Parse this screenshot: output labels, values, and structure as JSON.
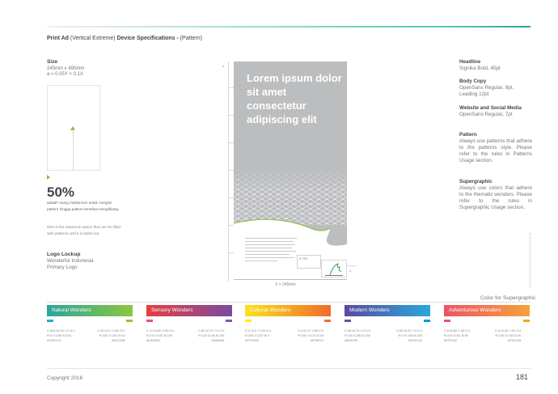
{
  "header": {
    "title_a": "Print Ad",
    "title_b": " (Vertical Extreme) ",
    "title_c": "Device Specifications - ",
    "title_d": "(Pattern)"
  },
  "left": {
    "size_label": "Size",
    "size_dim": "245mm x 490mm",
    "size_ratio": "a = 0.05Y × 0.1X",
    "percent": "50%",
    "percent_note": "adalah ruang maksimum untuk mengisi pattern hingga pattern tersebut menghilang.",
    "percent_note_en": "50% is the maximum space that can be filled with patterns until it is faded out",
    "logo_label": "Logo Lockup",
    "logo_line1": "Wonderful Indonesia",
    "logo_line2": "Primary Logo"
  },
  "ad": {
    "headline": "Lorem ipsum dolor sit amet consectetur adipiscing elit",
    "dim_bottom": "X = 245mm",
    "dim_side": "a",
    "dim_side_b": "a",
    "small_box": "0.75X",
    "colors": {
      "bg": "#bcbdbf",
      "accent": "#8ab83a"
    }
  },
  "specs": [
    {
      "heading": "Headline",
      "text": "Signika Bold, 45pt"
    },
    {
      "heading": "Body Copy",
      "text": "OpenSans Regular, 9pt, Leading 12pt"
    },
    {
      "heading": "Website and Social Media",
      "text": "OpenSans Regular, 7pt"
    },
    {
      "heading": "Pattern",
      "text": "Always use patterns that adhere to the patterns style. Please refer to the rules in Patterns Usage section."
    },
    {
      "heading": "Supergraphic",
      "text": "Always use colors that adhere to the thematic wonders. Please refer to the rules in Supergraphic Usage section."
    }
  ],
  "color_section": {
    "title": "Color for Supergraphic",
    "swatches": [
      {
        "label": "Natural Wonders",
        "from": "#2aa59c",
        "to": "#8dc63f",
        "left_code": "C:080 M:25 Y:0 K:0\nR:0 G:156 B:205\n#009CCD",
        "right_code": "C:45 M:0 Y:100 K:0\nR:150 G:201 B:43\n#96C92B"
      },
      {
        "label": "Sensory Wonders",
        "from": "#e4403f",
        "to": "#7b4aa2",
        "left_code": "C:12 M:80 Y:58 K:0\nR:234 G:82 B:109\n#EA526D",
        "right_code": "C:60 M:75 Y:0 K:0\nR:132 G:86 B:166\n#8456A6"
      },
      {
        "label": "Cultural Wonders",
        "from": "#f9e31c",
        "to": "#f26b2c",
        "left_code": "C:0 M:0 Y:100 K:0\nR:255 G:237 B:0\n#FFED00",
        "right_code": "C:0 M:70 Y:85 K:0\nR:240 G:110 B:49\n#EF6E31"
      },
      {
        "label": "Modern Wonders",
        "from": "#5b4a9e",
        "to": "#2aa7dc",
        "left_code": "C:68 M:75 Y:0 K:0\nR:110 G:80 B:158\n#6E509E",
        "right_code": "C:80 M:25 Y:0 K:0\nR:0 G:156 B:205\n#009CCD"
      },
      {
        "label": "Adventurous Wonders",
        "from": "#ea5566",
        "to": "#f7a23a",
        "left_code": "C:0 M:80 Y:45 K:0\nR:240 G:81 B:98\n#EF5162",
        "right_code": "C:0 M:45 Y:90 K:0\nR:246 G:162 B:40\n#F5A228"
      }
    ]
  },
  "footer": {
    "copyright": "Copyright 2016",
    "page_number": "181"
  }
}
